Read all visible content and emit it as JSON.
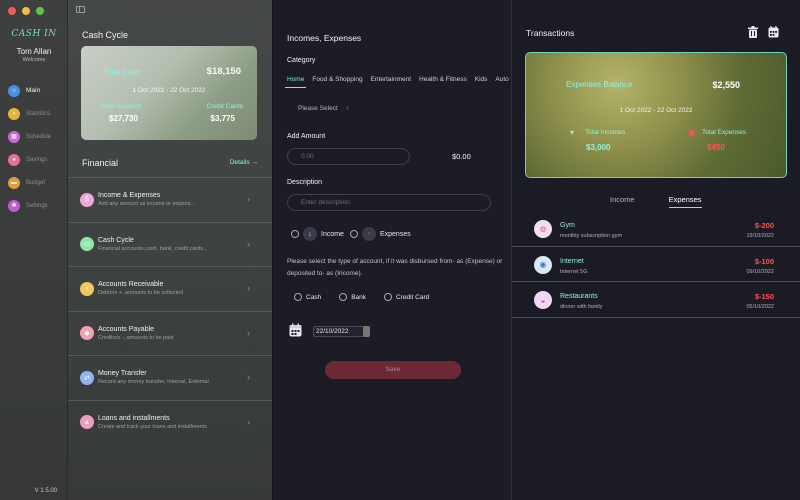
{
  "sidebar": {
    "logo": "CASH IN",
    "user_name": "Tom Allan",
    "user_sub": "Welcome",
    "items": [
      {
        "label": "Main",
        "icon": "home-icon",
        "color": "#4a8fe6"
      },
      {
        "label": "Statistics",
        "icon": "chart-icon",
        "color": "#e7b340"
      },
      {
        "label": "Schedule",
        "icon": "calendar-icon",
        "color": "#c86ad9"
      },
      {
        "label": "Savings",
        "icon": "piggy-bank-icon",
        "color": "#e96c9d"
      },
      {
        "label": "Budget",
        "icon": "wallet-icon",
        "color": "#e89b3a"
      },
      {
        "label": "Settings",
        "icon": "gear-icon",
        "color": "#c25bd0"
      }
    ],
    "version": "V 1.5.00"
  },
  "cash_cycle": {
    "title": "Cash Cycle",
    "total_label": "Total Cash",
    "total_value": "$18,150",
    "dates": "1 Oct 2022 - 22 Oct 2022",
    "bank_label": "Bank Account",
    "bank_value": "$27,730",
    "credit_label": "Credit Cards",
    "credit_value": "$3,775"
  },
  "financial": {
    "title": "Financial",
    "details": "Details →",
    "items": [
      {
        "title": "Income & Expenses",
        "desc": "Add any amount as income or expens...",
        "color": "#f0a6d8",
        "icon": "💲"
      },
      {
        "title": "Cash Cycle",
        "desc": "Financial accounts,cash, bank, credit cards..",
        "color": "#8fe6a8",
        "icon": "💵"
      },
      {
        "title": "Accounts Receivable",
        "desc": "Debtors +, amounts to be collected",
        "color": "#f3c95a",
        "icon": "👛"
      },
      {
        "title": "Accounts Payable",
        "desc": "Creditors -, amounts to be paid",
        "color": "#f49fb2",
        "icon": "💸"
      },
      {
        "title": "Money Transfer",
        "desc": "Record any money transfer, Internal, External",
        "color": "#8fb6f2",
        "icon": "🔄"
      },
      {
        "title": "Loans and installments",
        "desc": "Create and track your loans and installments",
        "color": "#f29ac0",
        "icon": "🏦"
      }
    ]
  },
  "form": {
    "title": "Incomes, Expenses",
    "category_label": "Category",
    "categories": [
      "Home",
      "Food & Shopping",
      "Entertainment",
      "Health & Fitness",
      "Kids",
      "Auto"
    ],
    "please_select": "Please Select",
    "amount_label": "Add Amount",
    "amount_placeholder": "0.00",
    "amount_display": "$0.00",
    "desc_label": "Description",
    "desc_placeholder": "Enter description",
    "income_label": "Income",
    "expenses_label": "Expenses",
    "info_text": "Please select the type of account, if it was disbursed from- as (Expense) or deposited to- as (Income).",
    "accounts": [
      "Cash",
      "Bank",
      "Credit Card"
    ],
    "date": "22/10/2022",
    "save_label": "Save"
  },
  "transactions": {
    "title": "Transactions",
    "balance_label": "Expenses Balance",
    "balance_value": "$2,550",
    "dates": "1 Oct 2022 - 22 Oct 2022",
    "income_label": "Total Incomes",
    "income_value": "$3,000",
    "expense_label": "Total Expenses",
    "expense_value": "$450",
    "tabs": [
      "Income",
      "Expenses"
    ],
    "items": [
      {
        "title": "Gym",
        "desc": "monthly subscription gym",
        "amount": "$-200",
        "date": "19/10/2022",
        "icon": "🏋"
      },
      {
        "title": "Internet",
        "desc": "Internet 5G",
        "amount": "$-100",
        "date": "09/10/2022",
        "icon": "📶"
      },
      {
        "title": "Restaurants",
        "desc": "dinner with family",
        "amount": "$-150",
        "date": "05/10/2022",
        "icon": "🍽"
      }
    ]
  }
}
